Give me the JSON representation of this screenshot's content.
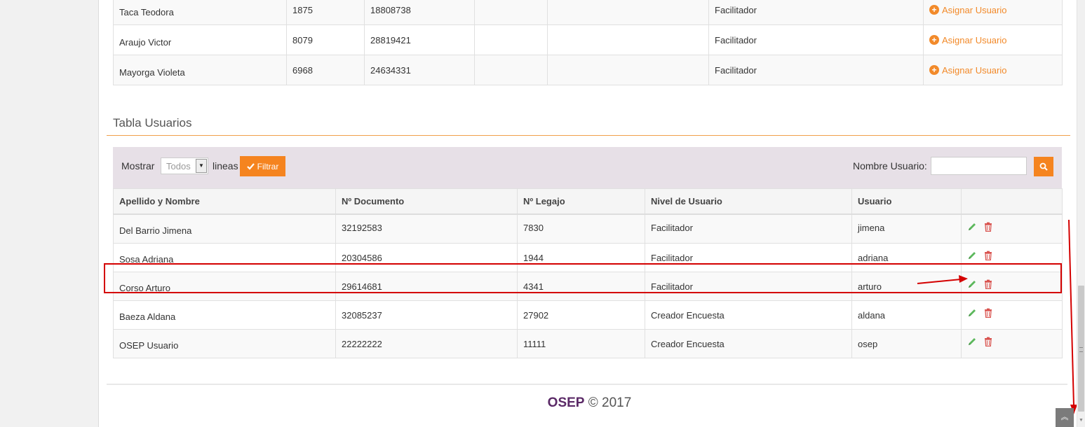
{
  "top_table": {
    "rows": [
      {
        "name": "Taca Teodora",
        "legajo": "1875",
        "documento": "18808738",
        "col4": "",
        "col5": "",
        "nivel": "Facilitador",
        "action": "Asignar Usuario"
      },
      {
        "name": "Araujo Victor",
        "legajo": "8079",
        "documento": "28819421",
        "col4": "",
        "col5": "",
        "nivel": "Facilitador",
        "action": "Asignar Usuario"
      },
      {
        "name": "Mayorga Violeta",
        "legajo": "6968",
        "documento": "24634331",
        "col4": "",
        "col5": "",
        "nivel": "Facilitador",
        "action": "Asignar Usuario"
      }
    ]
  },
  "section": {
    "title": "Tabla Usuarios"
  },
  "toolbar": {
    "show_label": "Mostrar",
    "select_value": "Todos",
    "lines_label": "lineas",
    "filter_label": "Filtrar",
    "search_label": "Nombre Usuario:",
    "search_value": ""
  },
  "users_table": {
    "headers": [
      "Apellido y Nombre",
      "Nº Documento",
      "Nº Legajo",
      "Nivel de Usuario",
      "Usuario",
      ""
    ],
    "rows": [
      {
        "name": "Del Barrio Jimena",
        "documento": "32192583",
        "legajo": "7830",
        "nivel": "Facilitador",
        "usuario": "jimena"
      },
      {
        "name": "Sosa Adriana",
        "documento": "20304586",
        "legajo": "1944",
        "nivel": "Facilitador",
        "usuario": "adriana"
      },
      {
        "name": "Corso Arturo",
        "documento": "29614681",
        "legajo": "4341",
        "nivel": "Facilitador",
        "usuario": "arturo"
      },
      {
        "name": "Baeza Aldana",
        "documento": "32085237",
        "legajo": "27902",
        "nivel": "Creador Encuesta",
        "usuario": "aldana"
      },
      {
        "name": "OSEP Usuario",
        "documento": "22222222",
        "legajo": "11111",
        "nivel": "Creador Encuesta",
        "usuario": "osep"
      }
    ]
  },
  "footer": {
    "brand": "OSEP",
    "copyright": "© 2017"
  },
  "colors": {
    "accent": "#f5841f",
    "edit": "#5cb85c",
    "delete": "#d9534f",
    "annotation": "#d40000",
    "brand": "#5b2a67"
  },
  "icons": {
    "assign": "plus-circle-icon",
    "filter": "check-icon",
    "search": "search-icon",
    "edit": "pencil-icon",
    "delete": "trash-icon",
    "back_to_top": "double-chevron-up-icon"
  }
}
